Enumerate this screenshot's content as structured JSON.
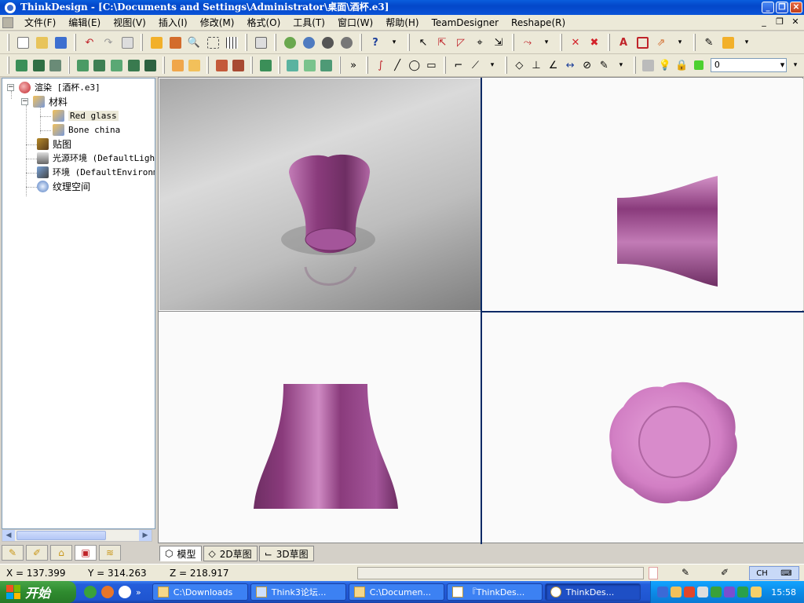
{
  "window": {
    "title": "ThinkDesign  - [C:\\Documents and Settings\\Administrator\\桌面\\酒杯.e3]"
  },
  "menu": [
    "文件(F)",
    "编辑(E)",
    "视图(V)",
    "插入(I)",
    "修改(M)",
    "格式(O)",
    "工具(T)",
    "窗口(W)",
    "帮助(H)",
    "TeamDesigner",
    "Reshape(R)"
  ],
  "toolbar": {
    "layer_value": "0",
    "more_glyph": "»"
  },
  "tree": {
    "root": "渲染 [酒杯.e3]",
    "materials": "材料",
    "mat1": "Red glass",
    "mat2": "Bone china",
    "texture": "贴图",
    "light": "光源环境 (DefaultLigh",
    "env": "环境 (DefaultEnvironm",
    "space": "纹理空间"
  },
  "bottom_tabs": [
    "模型",
    "2D草图",
    "3D草图"
  ],
  "status": {
    "x": "X = 137.399",
    "y": "Y = 314.263",
    "z": "Z = 218.917",
    "ime": "CH"
  },
  "taskbar": {
    "start": "开始",
    "tasks": [
      "C:\\Downloads",
      "Think3论坛...",
      "C:\\Documen...",
      "『ThinkDes...",
      "ThinkDes..."
    ],
    "clock": "15:58"
  },
  "colors": {
    "accent": "#0a53d8",
    "vase": "#8a3b7c",
    "vase_light": "#d27fc4",
    "sep": "#0b2a66"
  }
}
